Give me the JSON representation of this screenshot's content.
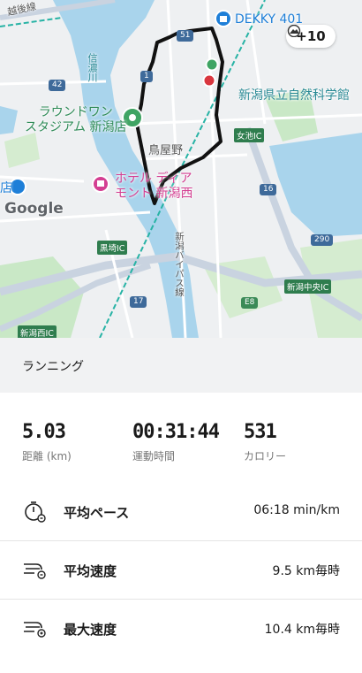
{
  "map": {
    "labels": {
      "round1": "ラウンドワン\nスタジアム 新潟店",
      "hotel": "ホテル ディア\nモント 新潟西",
      "science_museum": "新潟県立自然科学館",
      "dekky": "DEKKY 401",
      "toriyano": "鳥屋野",
      "shinano_river": "信濃川",
      "echigo_line": "越後線",
      "joetsu_line": "新潟バイパス線",
      "ten": "店",
      "google": "Google"
    },
    "ic_signs": {
      "meike": "女池IC",
      "kurosaki": "黒埼IC",
      "niigata_chuo": "新潟中央IC",
      "niigata_nishi": "新潟西IC"
    },
    "route_shields": {
      "r51": "51",
      "r42": "42",
      "r1": "1",
      "r16": "16",
      "r290": "290",
      "r17": "17",
      "e8": "E8"
    },
    "weather_value": "+10"
  },
  "activity": {
    "type_label": "ランニング"
  },
  "stats": [
    {
      "value": "5.03",
      "label": "距離 (km)"
    },
    {
      "value": "00:31:44",
      "label": "運動時間"
    },
    {
      "value": "531",
      "label": "カロリー"
    }
  ],
  "metrics": [
    {
      "label": "平均ペース",
      "value": "06:18 min/km",
      "icon": "stopwatch-icon"
    },
    {
      "label": "平均速度",
      "value": "9.5 km毎時",
      "icon": "speed-average-icon"
    },
    {
      "label": "最大速度",
      "value": "10.4 km毎時",
      "icon": "speed-max-icon"
    }
  ],
  "colors": {
    "route": "#111111",
    "start_marker": "#3fa463",
    "end_marker": "#d9363e",
    "water": "#a9d4ec",
    "park": "#c9e8c6",
    "highway": "#c9d3e0"
  }
}
